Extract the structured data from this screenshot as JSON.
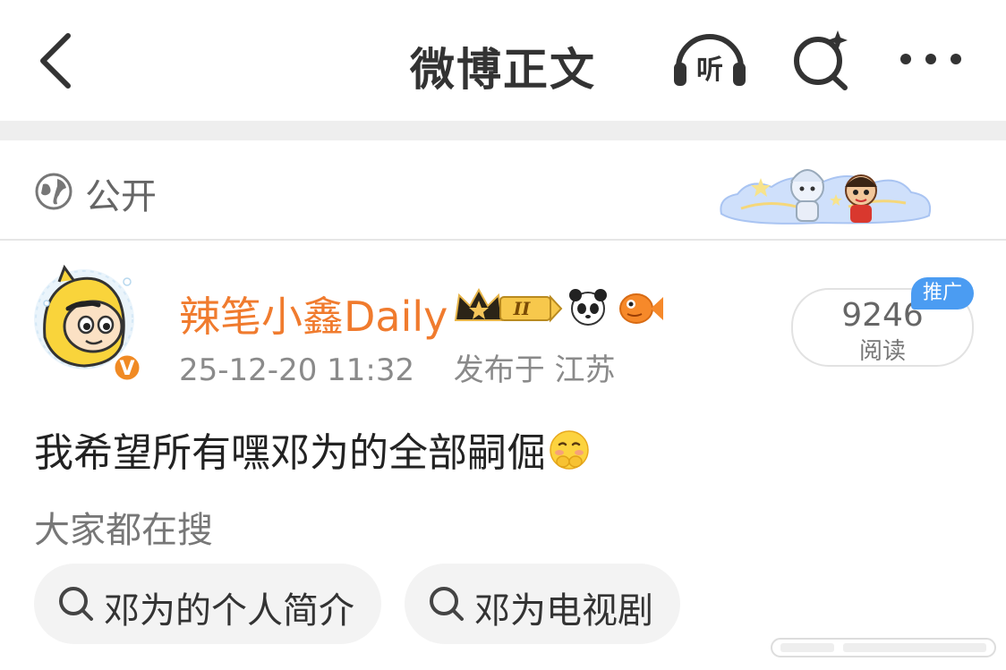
{
  "header": {
    "title": "微博正文"
  },
  "visibility": {
    "label": "公开"
  },
  "post": {
    "author": "辣笔小鑫Daily",
    "timestamp": "25-12-20 11:32",
    "location": "发布于 江苏",
    "read_count": "9246",
    "read_label": "阅读",
    "promo_badge": "推广",
    "content": "我希望所有嘿邓为的全部嗣倔"
  },
  "search": {
    "title": "大家都在搜",
    "chips": [
      "邓为的个人简介",
      "邓为电视剧"
    ]
  },
  "colors": {
    "accent_orange": "#f07b2e",
    "promo_blue": "#4b9cf2",
    "divider": "#eeeeee"
  }
}
